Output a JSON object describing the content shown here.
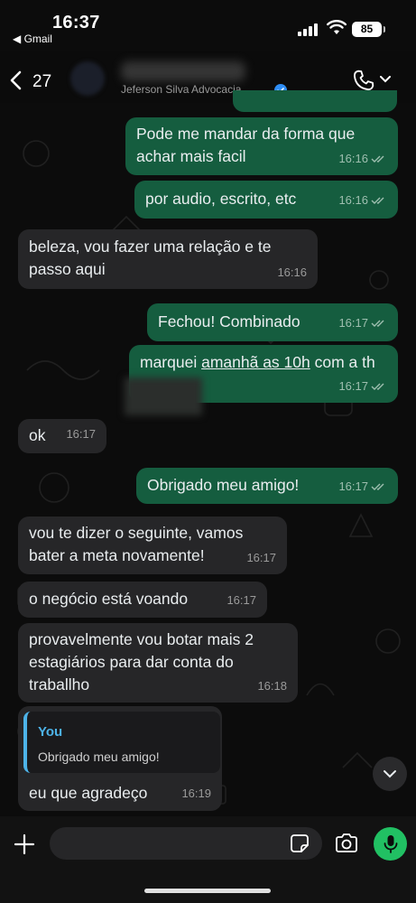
{
  "status_bar": {
    "time": "16:37",
    "back_app": "◀ Gmail",
    "battery": "85"
  },
  "header": {
    "unread_count": "27",
    "contact_subtitle": "Jeferson Silva Advocacia"
  },
  "messages": [
    {
      "text": "Pode me mandar da forma que achar mais facil",
      "time": "16:16",
      "dir": "out"
    },
    {
      "text": "por audio, escrito, etc",
      "time": "16:16",
      "dir": "out"
    },
    {
      "text": "beleza, vou fazer uma relação e te passo aqui",
      "time": "16:16",
      "dir": "in"
    },
    {
      "text": "Fechou! Combinado",
      "time": "16:17",
      "dir": "out"
    },
    {
      "text_before": "marquei ",
      "text_link": "amanhã as 10h",
      "text_after": " com a th",
      "time": "16:17",
      "dir": "out"
    },
    {
      "text": "ok",
      "time": "16:17",
      "dir": "in"
    },
    {
      "text": "Obrigado meu amigo!",
      "time": "16:17",
      "dir": "out"
    },
    {
      "text": "vou te dizer o seguinte, vamos bater a meta novamente!",
      "time": "16:17",
      "dir": "in"
    },
    {
      "text": "o negócio está voando",
      "time": "16:17",
      "dir": "in"
    },
    {
      "text": "provavelmente vou botar mais 2 estagiários para dar conta do traballho",
      "time": "16:18",
      "dir": "in"
    },
    {
      "reply_author": "You",
      "reply_text": "Obrigado meu amigo!",
      "text": "eu que agradeço",
      "time": "16:19",
      "dir": "in"
    }
  ],
  "colors": {
    "outgoing": "#155d3f",
    "incoming": "#262628",
    "accent": "#21c063",
    "quote": "#4db3e8"
  },
  "icons": [
    "back-chevron-icon",
    "phone-icon",
    "chevron-down-icon",
    "verified-icon",
    "double-check-icon",
    "plus-icon",
    "sticker-icon",
    "camera-icon",
    "mic-icon"
  ]
}
